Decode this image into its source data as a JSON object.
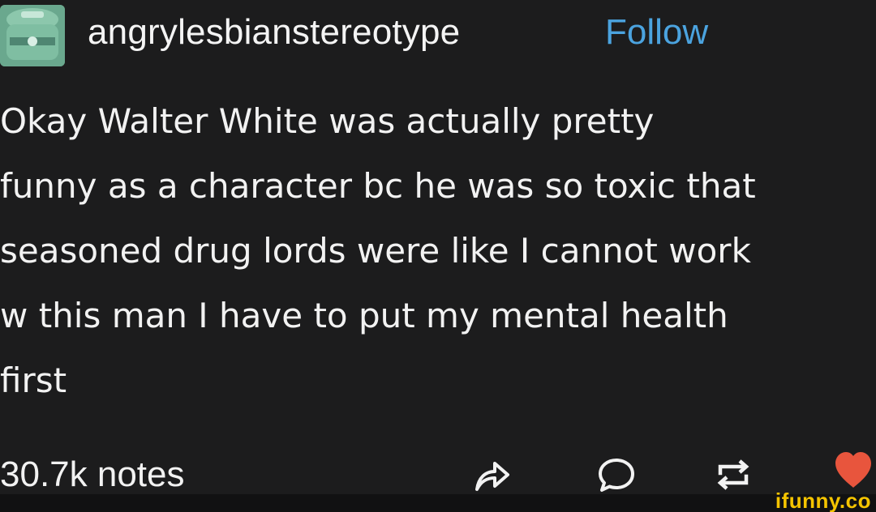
{
  "post": {
    "username": "angrylesbianstereotype",
    "follow_label": "Follow",
    "text_lines": [
      "Okay Walter White was actually pretty",
      "funny as a character bc he was so toxic that",
      "seasoned drug lords were like I cannot work",
      "w this man I have to put my mental health",
      "first"
    ],
    "notes": "30.7k notes"
  },
  "actions": {
    "icons": [
      "share-icon",
      "reply-icon",
      "reblog-icon",
      "heart-icon"
    ]
  },
  "watermark": {
    "text": "ifunny.co"
  },
  "colors": {
    "background": "#1c1c1d",
    "text": "#f2f2f2",
    "follow": "#4ba3df",
    "heart": "#e8553d",
    "watermark": "#f5c400",
    "avatar": "#78b49a"
  }
}
